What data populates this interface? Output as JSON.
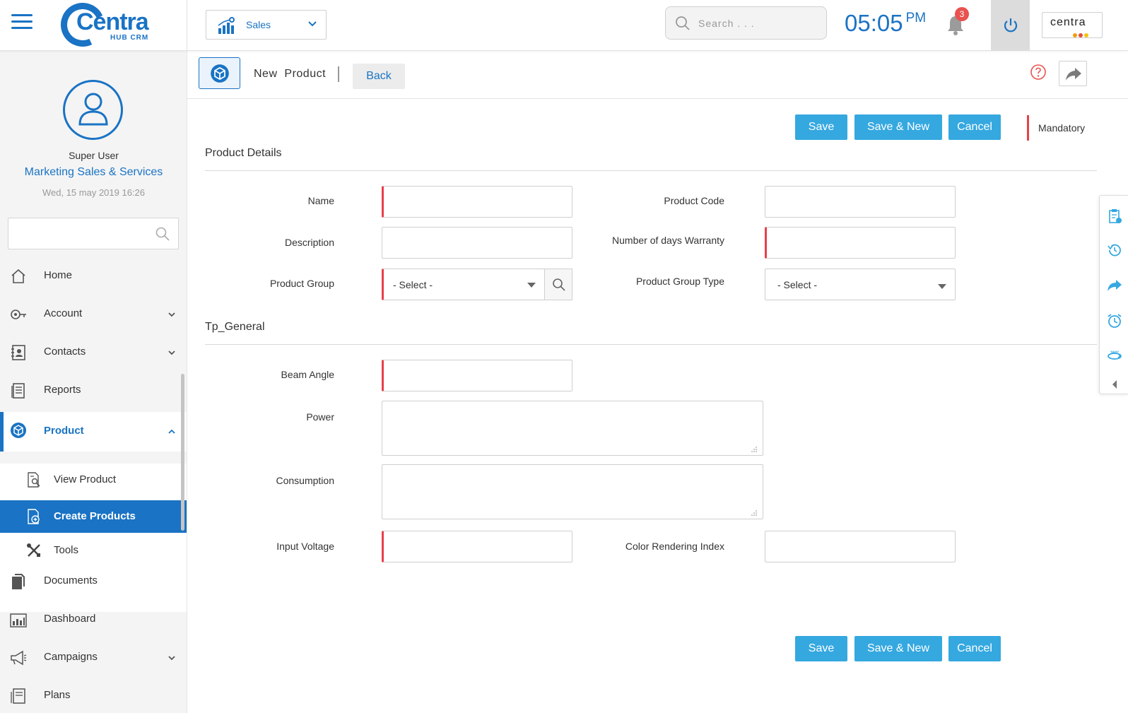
{
  "header": {
    "logo_text": "Centra",
    "logo_sub": "HUB CRM",
    "module": "Sales",
    "search_placeholder": "Search . . .",
    "time": "05:05",
    "ampm": "PM",
    "notification_count": "3",
    "brand_text": "centra"
  },
  "user": {
    "name": "Super User",
    "role": "Marketing Sales & Services",
    "datetime": "Wed, 15 may 2019 16:26"
  },
  "sidebar": {
    "items": [
      {
        "label": "Home"
      },
      {
        "label": "Account"
      },
      {
        "label": "Contacts"
      },
      {
        "label": "Reports"
      },
      {
        "label": "Product"
      },
      {
        "label": "Documents"
      },
      {
        "label": "Dashboard"
      },
      {
        "label": "Campaigns"
      },
      {
        "label": "Plans"
      }
    ],
    "product_subitems": [
      {
        "label": "View Product"
      },
      {
        "label": "Create Products"
      },
      {
        "label": "Tools"
      }
    ]
  },
  "page": {
    "title": "New  Product",
    "back_label": "Back",
    "save_label": "Save",
    "save_new_label": "Save & New",
    "cancel_label": "Cancel",
    "mandatory_label": "Mandatory"
  },
  "sections": {
    "product_details": "Product Details",
    "tp_general": "Tp_General"
  },
  "fields": {
    "name": "Name",
    "product_code": "Product Code",
    "description": "Description",
    "warranty": "Number of days Warranty",
    "product_group": "Product Group",
    "product_group_type": "Product Group  Type",
    "select_placeholder": "- Select -",
    "beam_angle": "Beam Angle",
    "power": "Power",
    "consumption": "Consumption",
    "input_voltage": "Input Voltage",
    "cri": "Color Rendering Index"
  },
  "colors": {
    "primary": "#1a73c4",
    "button": "#35a8e0",
    "required": "#e8404a",
    "badge": "#e8524f"
  }
}
